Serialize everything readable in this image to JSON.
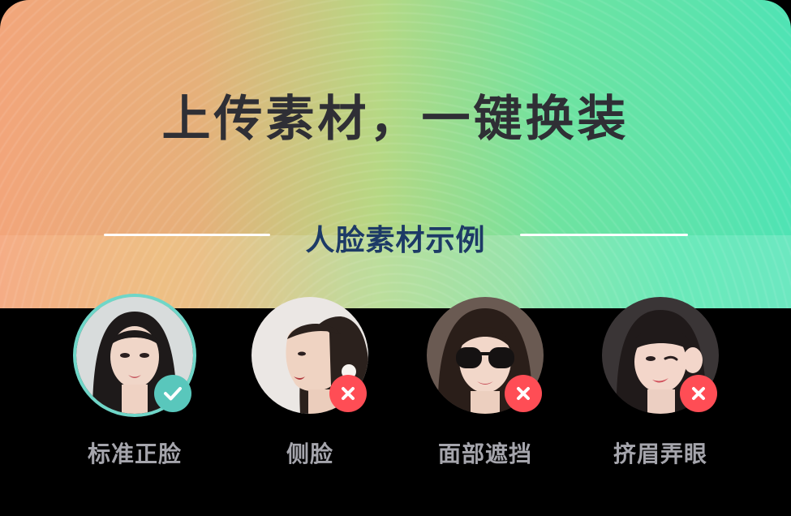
{
  "hero": {
    "headline": "上传素材，一键换装",
    "subtitle": "人脸素材示例"
  },
  "examples": [
    {
      "label": "标准正脸",
      "status": "ok",
      "status_icon": "check-icon"
    },
    {
      "label": "侧脸",
      "status": "bad",
      "status_icon": "x-icon"
    },
    {
      "label": "面部遮挡",
      "status": "bad",
      "status_icon": "x-icon"
    },
    {
      "label": "挤眉弄眼",
      "status": "bad",
      "status_icon": "x-icon"
    }
  ],
  "colors": {
    "headline": "#2f2f35",
    "subtitle": "#1d3a66",
    "ok_badge": "#59c7bc",
    "bad_badge": "#ff4d55",
    "label": "#a5a5ac",
    "background": "#000000"
  }
}
